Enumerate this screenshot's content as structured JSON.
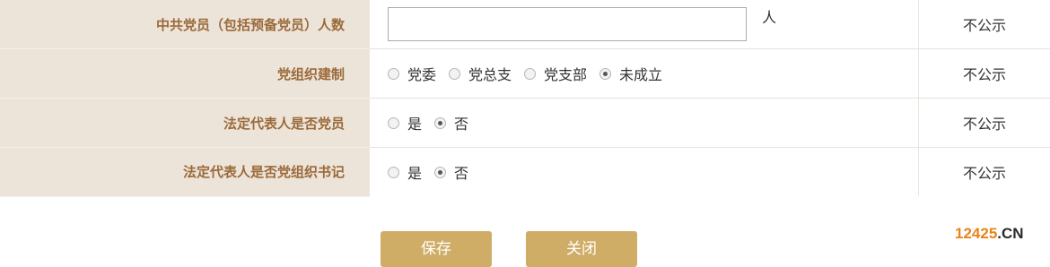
{
  "rows": [
    {
      "label": "中共党员（包括预备党员）人数",
      "input_value": "",
      "unit": "人",
      "public": "不公示"
    },
    {
      "label": "党组织建制",
      "options": [
        "党委",
        "党总支",
        "党支部",
        "未成立"
      ],
      "public": "不公示"
    },
    {
      "label": "法定代表人是否党员",
      "options": [
        "是",
        "否"
      ],
      "public": "不公示"
    },
    {
      "label": "法定代表人是否党组织书记",
      "options": [
        "是",
        "否"
      ],
      "public": "不公示"
    }
  ],
  "selected": {
    "org_structure": "未成立",
    "legal_rep_member": "否",
    "legal_rep_secretary": "否"
  },
  "buttons": {
    "save": "保存",
    "close": "关闭"
  },
  "watermark": {
    "number": "12425",
    "suffix": ".CN"
  },
  "colors": {
    "label_bg": "#ede4d9",
    "label_text": "#9a6a3a",
    "button_bg": "#cfad66",
    "watermark_orange": "#e8841a"
  }
}
